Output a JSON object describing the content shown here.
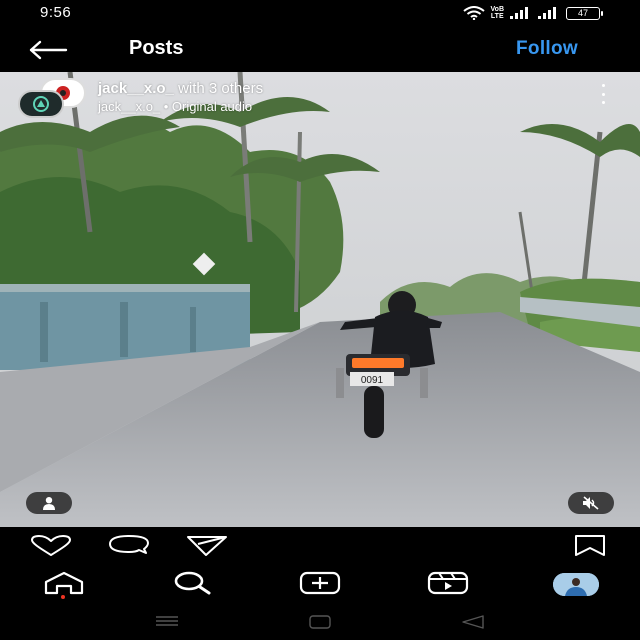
{
  "status_bar": {
    "time": "9:56",
    "volte_line1": "VoB",
    "volte_line2": "LTE",
    "battery": "47"
  },
  "header": {
    "title": "Posts",
    "follow_label": "Follow",
    "back_icon": "arrow-left-icon"
  },
  "post": {
    "username": "jack__x.o_",
    "collaborators": " with 3 others",
    "audio_line": "jack__x.o_ • Original audio",
    "more_icon": "more-vertical-icon",
    "tag_icon": "person-icon",
    "mute_icon": "speaker-muted-icon",
    "license_plate": "0091"
  },
  "actions": {
    "like_icon": "heart-icon",
    "comment_icon": "comment-icon",
    "share_icon": "send-icon",
    "save_icon": "bookmark-icon"
  },
  "bottom_nav": {
    "items": [
      "home-icon",
      "search-icon",
      "add-icon",
      "reels-icon",
      "profile-avatar"
    ]
  },
  "system_nav": {
    "items": [
      "menu-icon",
      "home-square-icon",
      "back-triangle-icon"
    ]
  },
  "colors": {
    "accent": "#3897f0",
    "background": "#000000",
    "notification_dot": "#ee3322"
  }
}
